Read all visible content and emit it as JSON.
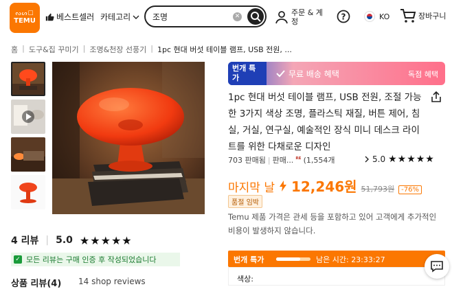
{
  "header": {
    "logo_glyphs": "ᔓᔕ☐",
    "logo_word": "TEMU",
    "bestseller_label": "베스트셀러",
    "category_label": "카테고리",
    "search_value": "조명",
    "account_label": "주문 & 계정",
    "language": "KO",
    "cart_label": "장바구니"
  },
  "breadcrumb": [
    "홈",
    "도구&집 꾸미기",
    "조명&천장 선풍기",
    "1pc 현대 버섯 테이블 램프, USB 전원, ..."
  ],
  "banner": {
    "tag": "번개 특가",
    "shipping": "무료 배송 혜택",
    "exclusive": "독점 혜택"
  },
  "product": {
    "title": "1pc 현대 버섯 테이블 램프, USB 전원, 조절 가능한 3가지 색상 조명, 플라스틱 재질, 버튼 제어, 침실, 거실, 연구실, 예술적인 장식 미니 데스크 라이트를 위한 다채로운 디자인",
    "sold": "703 판매됨",
    "seller_prefix": "판매...",
    "seller_count": "(1,554개",
    "rating": "5.0",
    "stars": "★★★★★"
  },
  "price": {
    "last_day": "마지막 날",
    "current": "12,246원",
    "original": "51,793원",
    "discount": "-76%",
    "badge": "품절 임박"
  },
  "notice": "Temu 제품 가격은 관세 등을 포함하고 있어 고객에게 추가적인 비용이 발생하지 않습니다.",
  "flash": {
    "label": "번개 특가",
    "progress": 0.7,
    "remaining_label": "남은 시간:",
    "remaining_time": "23:33:27",
    "color_label": "색상:"
  },
  "reviews": {
    "count_label": "4 리뷰",
    "rating": "5.0",
    "stars": "★★★★★",
    "verified_text": "모든 리뷰는 구매 인증 후 작성되었습니다",
    "product_reviews": "상품 리뷰(4)",
    "shop_reviews": "14 shop reviews"
  },
  "colors": {
    "brand": "#fb7701",
    "banner_blue": "#1f3fb6",
    "verified_green": "#1a9b3a"
  },
  "icons": [
    "thumbs-up-icon",
    "chevron-down-icon",
    "clear-icon",
    "search-icon",
    "user-icon",
    "help-icon",
    "korea-flag-icon",
    "cart-icon",
    "check-icon",
    "share-icon",
    "lightning-icon",
    "chat-icon",
    "play-icon"
  ]
}
